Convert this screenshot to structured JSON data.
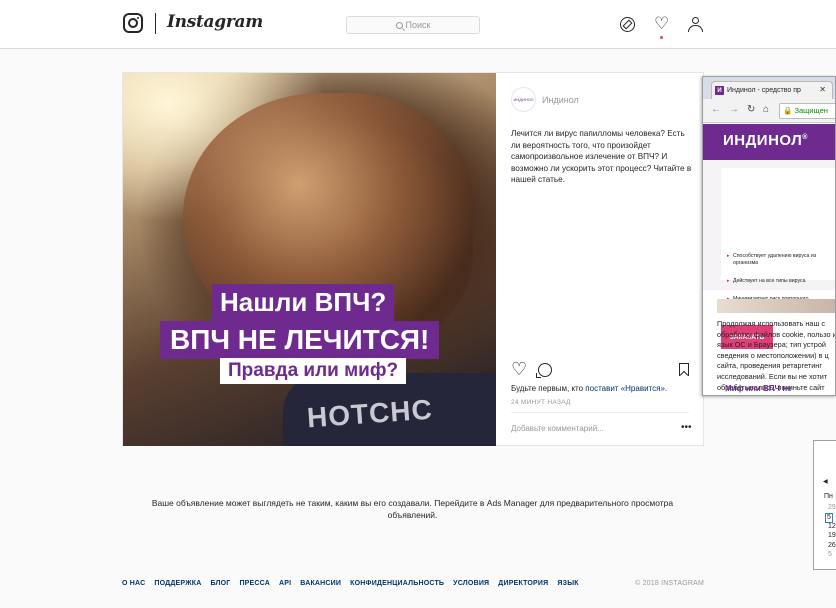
{
  "header": {
    "wordmark": "Instagram",
    "search_placeholder": "Поиск",
    "icons": [
      "camera-logo-icon",
      "compass-icon",
      "heart-icon",
      "user-icon"
    ],
    "notification_dot_color": "#ed4956"
  },
  "post": {
    "account_name": "Индинол",
    "avatar_text": "ИНДИНОЛ",
    "caption": "Лечится ли вирус папилломы человека? Есть ли вероятность того, что произойдет самопроизвольное излечение от ВПЧ? И возможно ли ускорить этот процесс? Читайте в нашей статье.",
    "image_text": {
      "line1": "Нашли ВПЧ?",
      "line2": "ВПЧ НЕ ЛЕЧИТСЯ!",
      "line3": "Правда или миф?",
      "shirt": "HOTCHC"
    },
    "likes_prefix": "Будьте первым, кто ",
    "likes_link": "поставит «Нравится».",
    "time": "24 МИНУТ НАЗАД",
    "comment_placeholder": "Добавьте комментарий...",
    "more": "•••",
    "accent": "#6e2a8f"
  },
  "notice": "Ваше объявление может выглядеть не таким, каким вы его создавали. Перейдите в Ads Manager для предварительного просмотра объявлений.",
  "footer": {
    "links": [
      "О НАС",
      "ПОДДЕРЖКА",
      "БЛОГ",
      "ПРЕССА",
      "API",
      "ВАКАНСИИ",
      "КОНФИДЕНЦИАЛЬНОСТЬ",
      "УСЛОВИЯ",
      "ДИРЕКТОРИЯ",
      "ЯЗЫК"
    ],
    "copyright": "© 2018 INSTAGRAM"
  },
  "landing": {
    "tab_title": "Индинол - средство пр",
    "favicon": "И",
    "address": "Защищен",
    "brand": "ИНДИНОЛ",
    "brand_mark": "®",
    "features": [
      "Способствует удалению вируса из организма",
      "Действует на все типы вируса",
      "Минимизирует риск повторного появления кондилом и папиллом"
    ],
    "order_button": "ЗАКАЗАТЬ",
    "cookie_text": "Продолжая использовать наш с обработку файлов cookie, пользо и язык ОС и Браузера; тип устрой сведения о местоположении) в ц сайта, проведения ретаргетинг исследований. Если вы не хотит обрабатывались, покиньте сайт",
    "link_text": "Миф или ВПЧ не"
  },
  "calendar": {
    "month_label": "Пн",
    "days": [
      "29",
      "5",
      "12",
      "19",
      "26",
      "5"
    ],
    "selected": "5"
  }
}
